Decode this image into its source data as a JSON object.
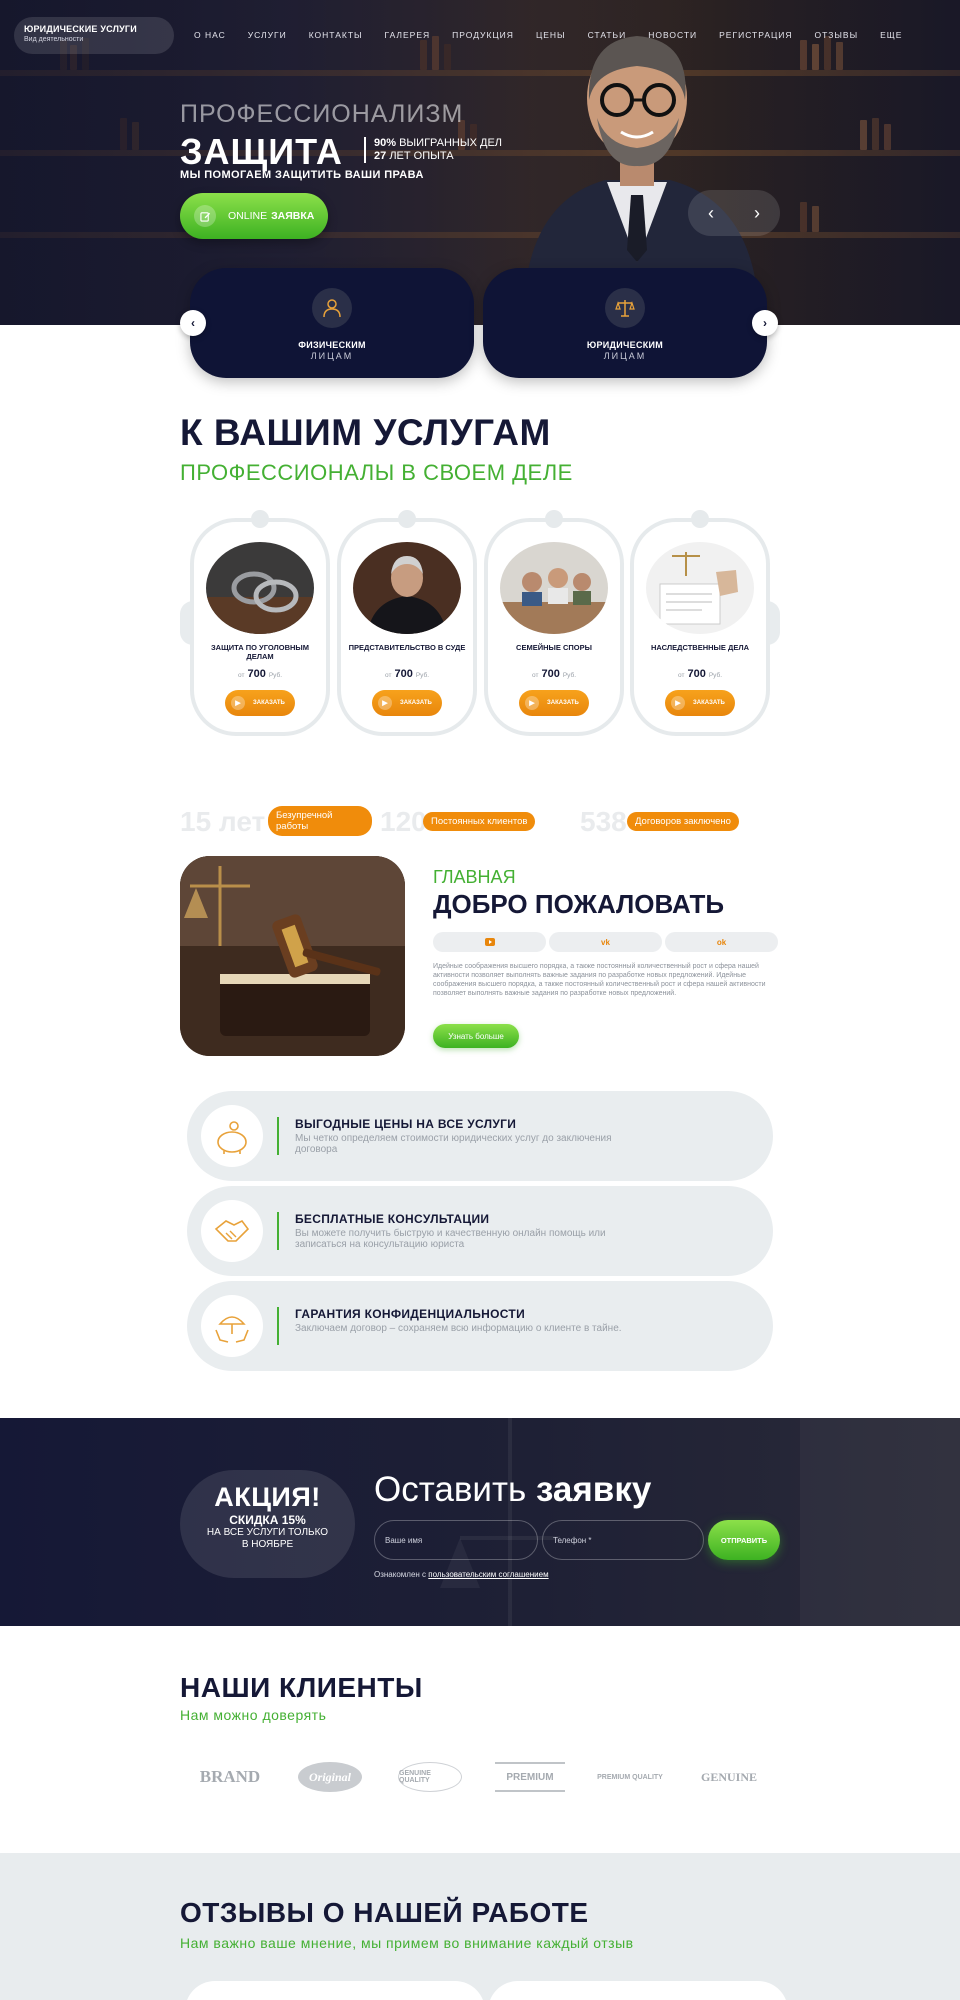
{
  "brand": {
    "title": "ЮРИДИЧЕСКИЕ УСЛУГИ",
    "subtitle": "Вид деятельности"
  },
  "nav": [
    "О НАС",
    "УСЛУГИ",
    "КОНТАКТЫ",
    "ГАЛЕРЕЯ",
    "ПРОДУКЦИЯ",
    "ЦЕНЫ",
    "СТАТЬИ",
    "НОВОСТИ",
    "РЕГИСТРАЦИЯ",
    "ОТЗЫВЫ",
    "ЕЩЕ"
  ],
  "hero": {
    "kicker": "ПРОФЕССИОНАЛИЗМ",
    "title": "ЗАЩИТА",
    "stat1_num": "90%",
    "stat1_text": "ВЫИГРАННЫХ ДЕЛ",
    "stat2_num": "27",
    "stat2_text": "ЛЕТ ОПЫТА",
    "tagline": "МЫ ПОМОГАЕМ ЗАЩИТИТЬ ВАШИ ПРАВА",
    "btn_light": "ONLINE",
    "btn_bold": "ЗАЯВКА",
    "arrow_prev": "‹",
    "arrow_next": "›"
  },
  "audience": [
    {
      "line1": "ФИЗИЧЕСКИМ",
      "line2": "ЛИЦАМ",
      "icon": "person-icon"
    },
    {
      "line1": "ЮРИДИЧЕСКИМ",
      "line2": "ЛИЦАМ",
      "icon": "scales-icon"
    }
  ],
  "services": {
    "title": "К ВАШИМ УСЛУГАМ",
    "subtitle": "ПРОФЕССИОНАЛЫ В СВОЕМ ДЕЛЕ",
    "items": [
      {
        "name": "ЗАЩИТА ПО УГОЛОВНЫМ ДЕЛАМ",
        "from": "от",
        "price": "700",
        "currency": "Руб.",
        "button": "ЗАКАЗАТЬ"
      },
      {
        "name": "ПРЕДСТАВИТЕЛЬСТВО В СУДЕ",
        "from": "от",
        "price": "700",
        "currency": "Руб.",
        "button": "ЗАКАЗАТЬ"
      },
      {
        "name": "СЕМЕЙНЫЕ СПОРЫ",
        "from": "от",
        "price": "700",
        "currency": "Руб.",
        "button": "ЗАКАЗАТЬ"
      },
      {
        "name": "НАСЛЕДСТВЕННЫЕ ДЕЛА",
        "from": "от",
        "price": "700",
        "currency": "Руб.",
        "button": "ЗАКАЗАТЬ"
      }
    ]
  },
  "stats": [
    {
      "number": "15 лет",
      "label": "Безупречной работы"
    },
    {
      "number": "120",
      "label": "Постоянных клиентов"
    },
    {
      "number": "538",
      "label": "Договоров заключено"
    }
  ],
  "welcome": {
    "kicker": "ГЛАВНАЯ",
    "title": "ДОБРО ПОЖАЛОВАТЬ",
    "socials": [
      "youtube-icon",
      "vk-icon",
      "odnoklassniki-icon"
    ],
    "text": "Идейные соображения высшего порядка, а также постоянный количественный рост и сфера нашей активности позволяет выполнять важные задания по разработке новых предложений. Идейные соображения высшего порядка, а также постоянный количественный рост и сфера нашей активности позволяет выполнять важные задания по разработке новых предложений.",
    "button": "Узнать больше"
  },
  "features": [
    {
      "title": "ВЫГОДНЫЕ ЦЕНЫ НА ВСЕ УСЛУГИ",
      "desc": "Мы четко определяем стоимости юридических услуг до заключения договора",
      "icon": "piggy-bank-icon"
    },
    {
      "title": "БЕСПЛАТНЫЕ КОНСУЛЬТАЦИИ",
      "desc": "Вы можете получить быструю и качественную онлайн помощь или записаться на консультацию юриста",
      "icon": "handshake-icon"
    },
    {
      "title": "ГАРАНТИЯ КОНФИДЕНЦИАЛЬНОСТИ",
      "desc": "Заключаем договор – сохраняем всю информацию о клиенте в тайне.",
      "icon": "umbrella-hands-icon"
    }
  ],
  "promo": {
    "badge_title": "АКЦИЯ!",
    "badge_discount": "СКИДКА 15%",
    "badge_line1": "НА ВСЕ УСЛУГИ ТОЛЬКО",
    "badge_line2": "В НОЯБРЕ",
    "title_light": "Оставить",
    "title_bold": "заявку",
    "name_placeholder": "Ваше имя",
    "phone_placeholder": "Телефон *",
    "submit": "ОТПРАВИТЬ",
    "agree_text": "Ознакомлен с",
    "agree_link": "пользовательским соглашением"
  },
  "clients": {
    "title": "НАШИ КЛИЕНТЫ",
    "subtitle": "Нам можно доверять",
    "logos": [
      "BRAND",
      "Original",
      "GENUINE QUALITY",
      "PREMIUM",
      "PREMIUM QUALITY",
      "GENUINE"
    ]
  },
  "reviews": {
    "title": "ОТЗЫВЫ О НАШЕЙ РАБОТЕ",
    "subtitle": "Нам важно ваше мнение, мы примем во внимание каждый отзыв"
  },
  "colors": {
    "navy": "#151836",
    "green": "#44b033",
    "orange": "#f08c0b",
    "light": "#e8ecee"
  }
}
